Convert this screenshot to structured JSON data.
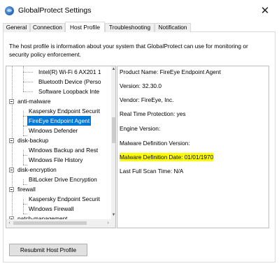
{
  "window": {
    "title": "GlobalProtect Settings",
    "close_glyph": "✕",
    "app_icon": "globalprotect-globe-icon"
  },
  "tabs": [
    {
      "label": "General",
      "active": false
    },
    {
      "label": "Connection",
      "active": false
    },
    {
      "label": "Host Profile",
      "active": true
    },
    {
      "label": "Troubleshooting",
      "active": false
    },
    {
      "label": "Notification",
      "active": false
    }
  ],
  "description": "The host profile is information about your system that GlobalProtect can use for monitoring or security policy enforcement.",
  "tree": {
    "items": [
      {
        "label": "Intel(R) Wi-Fi 6 AX201 1",
        "kind": "leaf"
      },
      {
        "label": "Bluetooth Device (Perso",
        "kind": "leaf"
      },
      {
        "label": "Software Loopback Inte",
        "kind": "leaf"
      },
      {
        "label": "anti-malware",
        "kind": "category"
      },
      {
        "label": "Kaspersky Endpoint Securit",
        "kind": "leaf"
      },
      {
        "label": "FireEye Endpoint Agent",
        "kind": "leaf",
        "selected": true
      },
      {
        "label": "Windows Defender",
        "kind": "leaf"
      },
      {
        "label": "disk-backup",
        "kind": "category"
      },
      {
        "label": "Windows Backup and Rest",
        "kind": "leaf"
      },
      {
        "label": "Windows File History",
        "kind": "leaf"
      },
      {
        "label": "disk-encryption",
        "kind": "category"
      },
      {
        "label": "BitLocker Drive Encryption",
        "kind": "leaf"
      },
      {
        "label": "firewall",
        "kind": "category"
      },
      {
        "label": "Kaspersky Endpoint Securit",
        "kind": "leaf"
      },
      {
        "label": "Windows Firewall",
        "kind": "leaf"
      },
      {
        "label": "patch-management",
        "kind": "category"
      }
    ],
    "scroll_up": "▲",
    "scroll_down": "▼",
    "scroll_left": "‹",
    "scroll_right": "›"
  },
  "details": [
    {
      "text": "Product Name: FireEye Endpoint Agent",
      "highlight": false
    },
    {
      "text": "Version: 32.30.0",
      "highlight": false
    },
    {
      "text": "Vendor: FireEye, Inc.",
      "highlight": false
    },
    {
      "text": "Real Time Protection: yes",
      "highlight": false
    },
    {
      "text": "Engine Version:",
      "highlight": false
    },
    {
      "text": "Malware Definition Version:",
      "highlight": false
    },
    {
      "text": "Malware Definition Date: 01/01/1970",
      "highlight": true
    },
    {
      "text": "Last Full Scan Time: N/A",
      "highlight": false
    }
  ],
  "buttons": {
    "resubmit": "Resubmit Host Profile"
  },
  "colors": {
    "selection": "#0078d7",
    "highlight": "#ffff00"
  }
}
